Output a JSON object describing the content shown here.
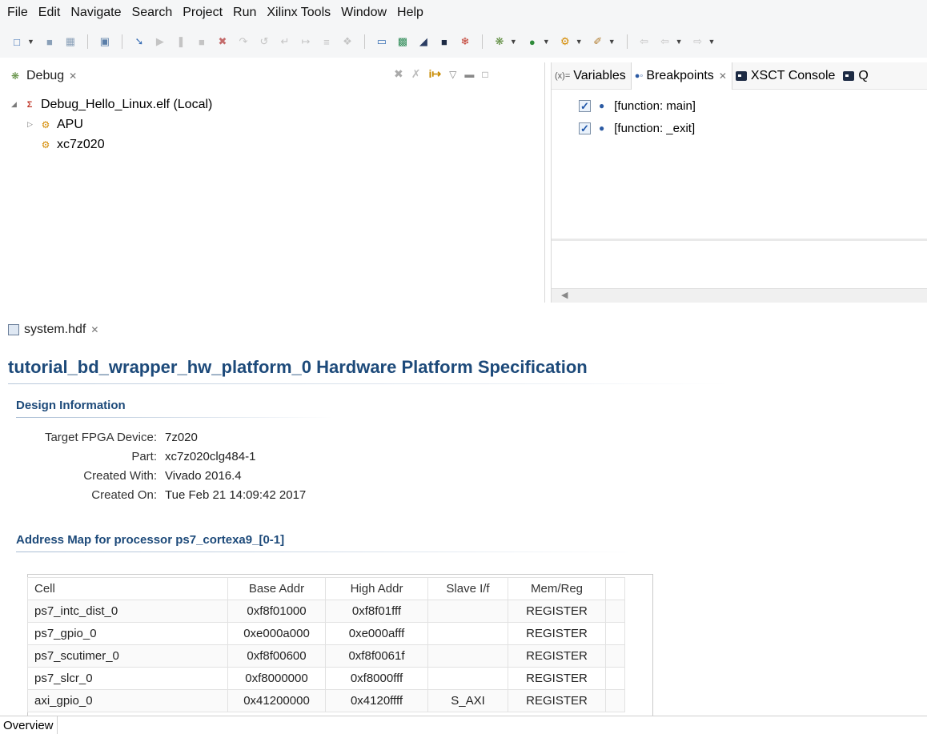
{
  "menu": [
    "File",
    "Edit",
    "Navigate",
    "Search",
    "Project",
    "Run",
    "Xilinx Tools",
    "Window",
    "Help"
  ],
  "debug_view": {
    "tab_label": "Debug",
    "tree": [
      {
        "label": "Debug_Hello_Linux.elf (Local)",
        "icon": "tcf-launch-icon",
        "level": 0,
        "expanded": true
      },
      {
        "label": "APU",
        "icon": "processor-gear-icon",
        "level": 1,
        "expanded": false
      },
      {
        "label": "xc7z020",
        "icon": "processor-gear-icon",
        "level": 1,
        "expanded": null
      }
    ]
  },
  "right_views": {
    "tabs": [
      {
        "label": "Variables",
        "icon": "variables-icon",
        "active": false
      },
      {
        "label": "Breakpoints",
        "icon": "breakpoints-icon",
        "active": true
      },
      {
        "label": "XSCT Console",
        "icon": "console-icon",
        "active": false
      },
      {
        "label": "Q",
        "icon": "console-icon",
        "active": false
      }
    ],
    "breakpoints": [
      {
        "label": "[function: main]",
        "checked": true
      },
      {
        "label": "[function: _exit]",
        "checked": true
      }
    ]
  },
  "editor": {
    "tab_label": "system.hdf",
    "title": "tutorial_bd_wrapper_hw_platform_0 Hardware Platform Specification",
    "design_info": {
      "heading": "Design Information",
      "rows": [
        {
          "label": "Target FPGA Device:",
          "value": "7z020"
        },
        {
          "label": "Part:",
          "value": "xc7z020clg484-1"
        },
        {
          "label": "Created With:",
          "value": "Vivado 2016.4"
        },
        {
          "label": "Created On:",
          "value": "Tue Feb 21 14:09:42 2017"
        }
      ]
    },
    "address_map": {
      "heading": "Address Map for processor ps7_cortexa9_[0-1]",
      "columns": [
        "Cell",
        "Base Addr",
        "High Addr",
        "Slave I/f",
        "Mem/Reg"
      ],
      "rows": [
        [
          "ps7_intc_dist_0",
          "0xf8f01000",
          "0xf8f01fff",
          "",
          "REGISTER"
        ],
        [
          "ps7_gpio_0",
          "0xe000a000",
          "0xe000afff",
          "",
          "REGISTER"
        ],
        [
          "ps7_scutimer_0",
          "0xf8f00600",
          "0xf8f0061f",
          "",
          "REGISTER"
        ],
        [
          "ps7_slcr_0",
          "0xf8000000",
          "0xf8000fff",
          "",
          "REGISTER"
        ],
        [
          "axi_gpio_0",
          "0x41200000",
          "0x4120ffff",
          "S_AXI",
          "REGISTER"
        ]
      ]
    },
    "bottom_tabs": [
      "Overview"
    ]
  }
}
